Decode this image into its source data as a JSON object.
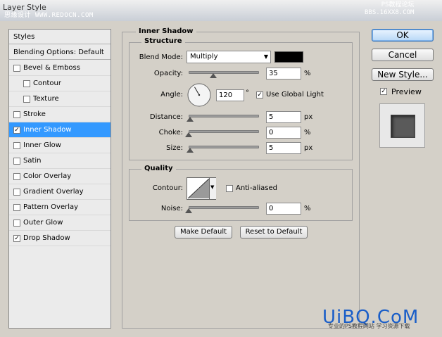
{
  "window": {
    "title": "Layer Style"
  },
  "watermarks": {
    "top_left": "思缘设计 WWW.REDOCN.COM",
    "top_right_1": "PS教程论坛",
    "top_right_2": "BBS.16XX8.COM",
    "bottom_logo": "UiBQ.CoM",
    "bottom_sub": "专业的PS教程网站 学习资源下载"
  },
  "styles_list": {
    "header": "Styles",
    "blending": "Blending Options: Default",
    "items": [
      {
        "label": "Bevel & Emboss",
        "checked": false,
        "indent": false
      },
      {
        "label": "Contour",
        "checked": false,
        "indent": true
      },
      {
        "label": "Texture",
        "checked": false,
        "indent": true
      },
      {
        "label": "Stroke",
        "checked": false,
        "indent": false
      },
      {
        "label": "Inner Shadow",
        "checked": true,
        "indent": false,
        "selected": true
      },
      {
        "label": "Inner Glow",
        "checked": false,
        "indent": false
      },
      {
        "label": "Satin",
        "checked": false,
        "indent": false
      },
      {
        "label": "Color Overlay",
        "checked": false,
        "indent": false
      },
      {
        "label": "Gradient Overlay",
        "checked": false,
        "indent": false
      },
      {
        "label": "Pattern Overlay",
        "checked": false,
        "indent": false
      },
      {
        "label": "Outer Glow",
        "checked": false,
        "indent": false
      },
      {
        "label": "Drop Shadow",
        "checked": true,
        "indent": false
      }
    ]
  },
  "inner_shadow": {
    "title": "Inner Shadow",
    "structure": {
      "title": "Structure",
      "blend_mode_label": "Blend Mode:",
      "blend_mode_value": "Multiply",
      "color": "#000000",
      "opacity_label": "Opacity:",
      "opacity_value": "35",
      "opacity_fraction": 0.35,
      "percent": "%",
      "angle_label": "Angle:",
      "angle_value": "120",
      "angle_deg": 120,
      "degree_sign": "°",
      "use_global_light_label": "Use Global Light",
      "use_global_light_checked": true,
      "distance_label": "Distance:",
      "distance_value": "5",
      "distance_fraction": 0.02,
      "choke_label": "Choke:",
      "choke_value": "0",
      "choke_fraction": 0.0,
      "size_label": "Size:",
      "size_value": "5",
      "size_fraction": 0.02,
      "px": "px"
    },
    "quality": {
      "title": "Quality",
      "contour_label": "Contour:",
      "anti_aliased_label": "Anti-aliased",
      "anti_aliased_checked": false,
      "noise_label": "Noise:",
      "noise_value": "0",
      "noise_fraction": 0.0,
      "percent": "%"
    },
    "make_default_label": "Make Default",
    "reset_default_label": "Reset to Default"
  },
  "buttons": {
    "ok": "OK",
    "cancel": "Cancel",
    "new_style": "New Style..."
  },
  "preview": {
    "label": "Preview",
    "checked": true
  }
}
